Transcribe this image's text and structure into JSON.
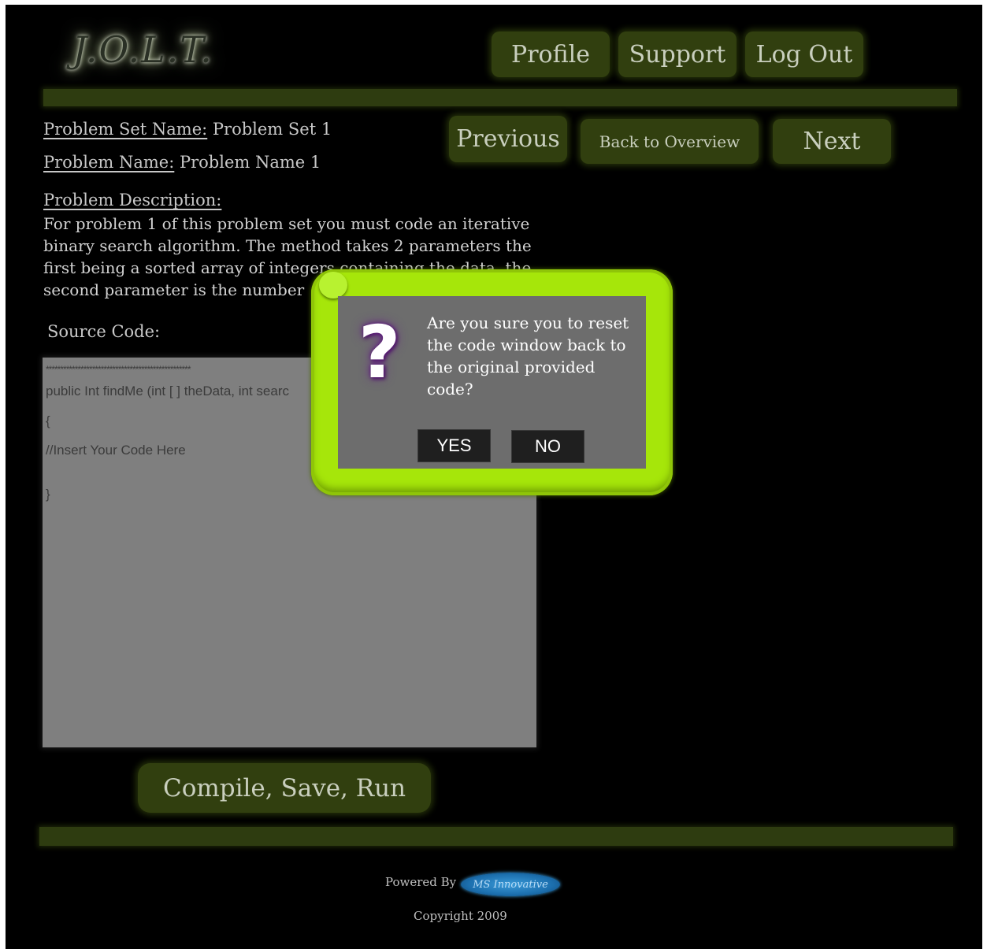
{
  "header": {
    "logo_text": "J.O.L.T.",
    "nav": {
      "profile": "Profile",
      "support": "Support",
      "logout": "Log Out"
    }
  },
  "problem": {
    "set_name_label": "Problem Set Name:",
    "set_name_value": " Problem Set 1",
    "name_label": "Problem Name:",
    "name_value": " Problem Name 1",
    "description_label": "Problem Description:",
    "description_text": "For problem 1 of this problem set you must code an iterative binary search algorithm. The method takes 2 parameters the first being a sorted array of integers containing the data, the second parameter is the number"
  },
  "pager": {
    "previous": "Previous",
    "overview": "Back to Overview",
    "next": "Next"
  },
  "editor": {
    "label": "Source Code:",
    "lines": [
      "**************************************************",
      "public Int findMe (int [ ] theData, int searc",
      "{",
      "//Insert Your Code Here",
      "}"
    ]
  },
  "actions": {
    "compile": "Compile, Save, Run"
  },
  "dialog": {
    "icon": "?",
    "message": "Are you sure you to reset the code window back to the original provided code?",
    "yes": "YES",
    "no": "NO"
  },
  "footer": {
    "powered_by": "Powered By",
    "brand_logo_text": "MS Innovative",
    "copyright": "Copyright 2009"
  },
  "colors": {
    "background": "#000000",
    "button_green": "#313f0f",
    "dialog_frame": "#a6e60a",
    "dialog_panel": "#6d6d6d",
    "editor_bg": "#7f7f7f"
  }
}
